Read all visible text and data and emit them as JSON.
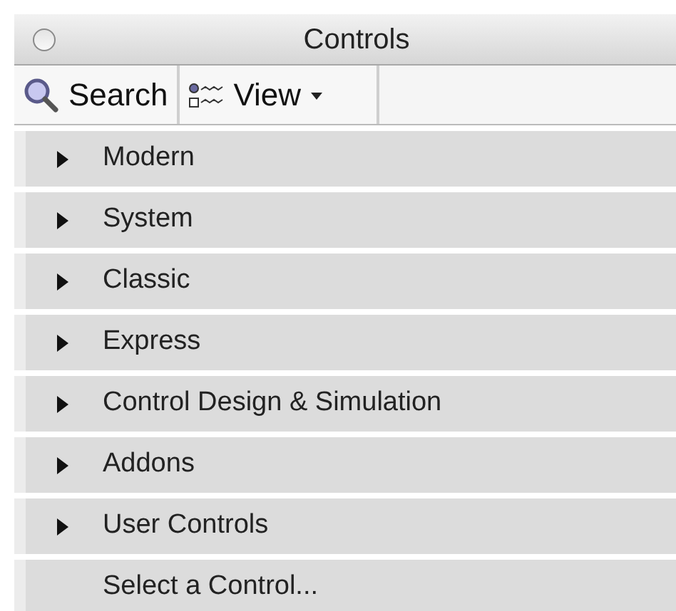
{
  "window": {
    "title": "Controls"
  },
  "toolbar": [
    {
      "kind": "search",
      "label": "Search"
    },
    {
      "kind": "view",
      "label": "View"
    }
  ],
  "palette": [
    {
      "kind": "category",
      "label": "Modern"
    },
    {
      "kind": "category",
      "label": "System"
    },
    {
      "kind": "category",
      "label": "Classic"
    },
    {
      "kind": "category",
      "label": "Express"
    },
    {
      "kind": "category",
      "label": "Control Design & Simulation"
    },
    {
      "kind": "category",
      "label": "Addons"
    },
    {
      "kind": "category",
      "label": "User Controls"
    },
    {
      "kind": "action",
      "label": "Select a Control..."
    }
  ]
}
